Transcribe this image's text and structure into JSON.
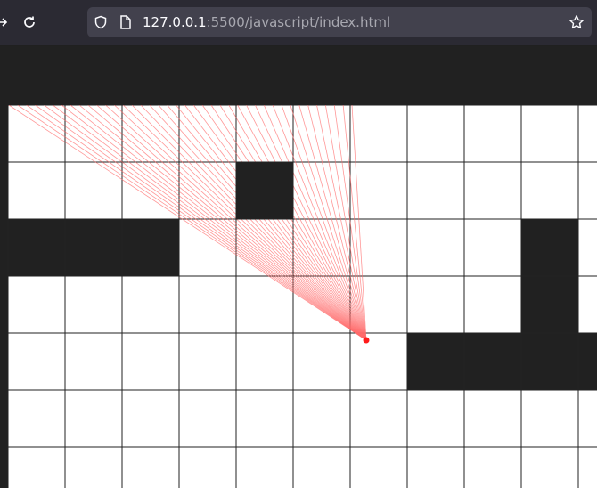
{
  "browser": {
    "url_host": "127.0.0.1",
    "url_path": ":5500/javascript/index.html",
    "icons": {
      "forward": "arrow-right-icon",
      "reload": "reload-icon",
      "shield": "shield-icon",
      "page": "page-icon",
      "bookmark": "star-icon"
    }
  },
  "map": {
    "cell_columns": 11,
    "cell_rows": 7,
    "walls": [
      [
        4,
        1
      ],
      [
        0,
        2
      ],
      [
        1,
        2
      ],
      [
        2,
        2
      ],
      [
        9,
        2
      ],
      [
        9,
        3
      ],
      [
        7,
        4
      ],
      [
        8,
        4
      ],
      [
        9,
        4
      ],
      [
        10,
        4
      ]
    ],
    "colors": {
      "background": "#212121",
      "floor": "#ffffff",
      "wall": "#212121",
      "grid_line": "#222222",
      "ray": "#ff6b6b",
      "player": "#ff1a1a"
    },
    "ray_count": 40
  }
}
